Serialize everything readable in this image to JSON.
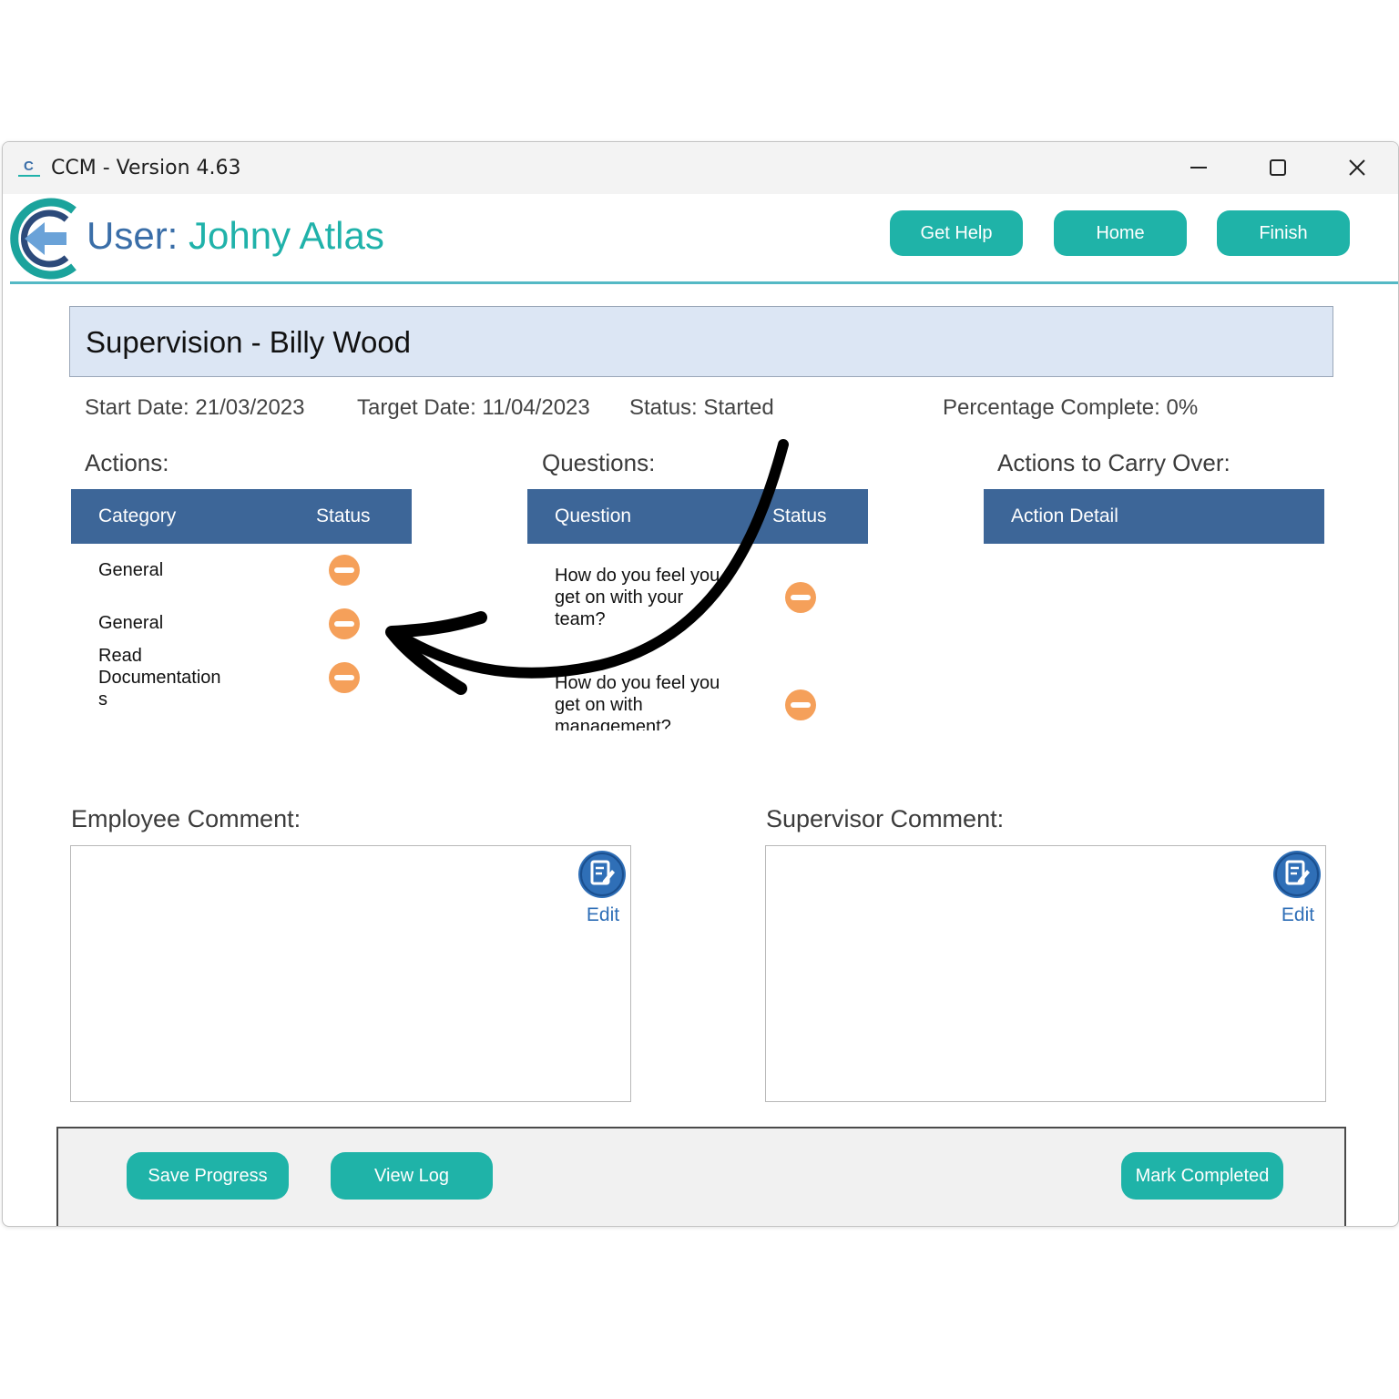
{
  "window": {
    "title": "CCM - Version 4.63"
  },
  "header": {
    "user_prefix": "User:",
    "user_name": "Johny Atlas",
    "buttons": [
      "Get Help",
      "Home",
      "Finish"
    ]
  },
  "supervision": {
    "title": "Supervision - Billy Wood",
    "start_date": "Start Date: 21/03/2023",
    "target_date": "Target Date: 11/04/2023",
    "status": "Status: Started",
    "percentage": "Percentage Complete: 0%"
  },
  "actions": {
    "label": "Actions:",
    "headers": [
      "Category",
      "Status"
    ],
    "rows": [
      {
        "category": [
          "General"
        ],
        "status_icon": "minus-circle-icon"
      },
      {
        "category": [
          "General"
        ],
        "status_icon": "minus-circle-icon"
      },
      {
        "category": [
          "Read",
          "Documentation",
          "s"
        ],
        "status_icon": "minus-circle-icon"
      }
    ]
  },
  "questions": {
    "label": "Questions:",
    "headers": [
      "Question",
      "Status"
    ],
    "rows": [
      {
        "question": [
          "How do you feel you",
          "get on with your",
          "team?"
        ],
        "status_icon": "minus-circle-icon"
      },
      {
        "question": [
          "How do you feel you",
          "get on with",
          "management?"
        ],
        "status_icon": "minus-circle-icon"
      }
    ]
  },
  "carry_over": {
    "label": "Actions to Carry Over:",
    "headers": [
      "Action Detail"
    ]
  },
  "comments": {
    "employee_label": "Employee Comment:",
    "supervisor_label": "Supervisor Comment:",
    "edit_label": "Edit"
  },
  "footer": {
    "save": "Save Progress",
    "view_log": "View Log",
    "mark_completed": "Mark Completed"
  },
  "colors": {
    "accent": "#1fb3a8",
    "table_header": "#3d6698",
    "status_pending": "#f5a05a",
    "edit_blue": "#2f6fb7"
  }
}
